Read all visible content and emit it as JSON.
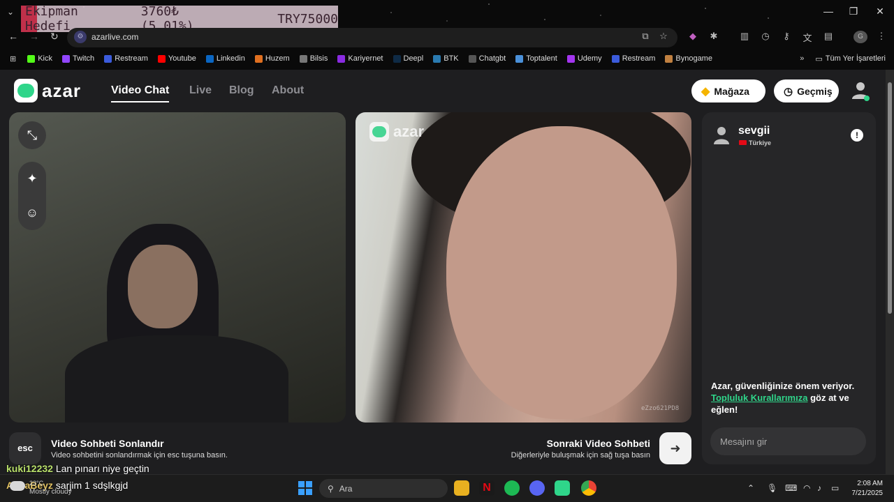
{
  "overlay": {
    "goal_label": "Ekipman Hedefi",
    "goal_progress": "3760₺ (5.01%)",
    "goal_target": "TRY75000",
    "progress_fraction": 0.0501
  },
  "browser": {
    "url": "azarlive.com",
    "bookmarks": [
      {
        "label": "Kick",
        "color": "#53fc18"
      },
      {
        "label": "Twitch",
        "color": "#9146ff"
      },
      {
        "label": "Restream",
        "color": "#3b5bdb"
      },
      {
        "label": "Youtube",
        "color": "#ff0000"
      },
      {
        "label": "Linkedin",
        "color": "#0a66c2"
      },
      {
        "label": "Huzem",
        "color": "#e07020"
      },
      {
        "label": "Bilsis",
        "color": "#777777"
      },
      {
        "label": "Kariyernet",
        "color": "#8a2be2"
      },
      {
        "label": "Deepl",
        "color": "#0f2b46"
      },
      {
        "label": "BTK",
        "color": "#2a7ab0"
      },
      {
        "label": "Chatgbt",
        "color": "#555555"
      },
      {
        "label": "Toptalent",
        "color": "#4a90d9"
      },
      {
        "label": "Udemy",
        "color": "#a435f0"
      },
      {
        "label": "Restream",
        "color": "#3b5bdb"
      },
      {
        "label": "Bynogame",
        "color": "#c08040"
      }
    ],
    "all_bookmarks": "Tüm Yer İşaretleri"
  },
  "site": {
    "logo_text": "azar",
    "nav": [
      "Video Chat",
      "Live",
      "Blog",
      "About"
    ],
    "shop_label": "Mağaza",
    "history_label": "Geçmiş"
  },
  "video": {
    "watermark": "azar",
    "id": "eZzo621PD8"
  },
  "partner": {
    "name": "sevgii",
    "country": "Türkiye"
  },
  "chat": {
    "safety_text": "Azar, güvenliğinize önem veriyor.",
    "safety_link": "Topluluk Kurallarımıza",
    "safety_after": "göz at ve eğlen!",
    "input_placeholder": "Mesajını gir"
  },
  "hints": {
    "esc_key": "esc",
    "end_title": "Video Sohbeti Sonlandır",
    "end_sub": "Video sohbetini sonlandırmak için esc tuşuna basın.",
    "next_title": "Sonraki Video Sohbeti",
    "next_sub": "Diğerleriyle buluşmak için sağ tuşa basın"
  },
  "stream_chat": [
    {
      "user": "kuki12232",
      "text": "Lan pınarı niye geçtin"
    },
    {
      "user": "AlinaBeyz",
      "text": "sarjim 1 sdşlkgjd"
    }
  ],
  "taskbar": {
    "weather_temp": "23°C",
    "weather": "Mostly cloudy",
    "search": "Ara",
    "time": "2:08 AM",
    "date": "7/21/2025"
  }
}
